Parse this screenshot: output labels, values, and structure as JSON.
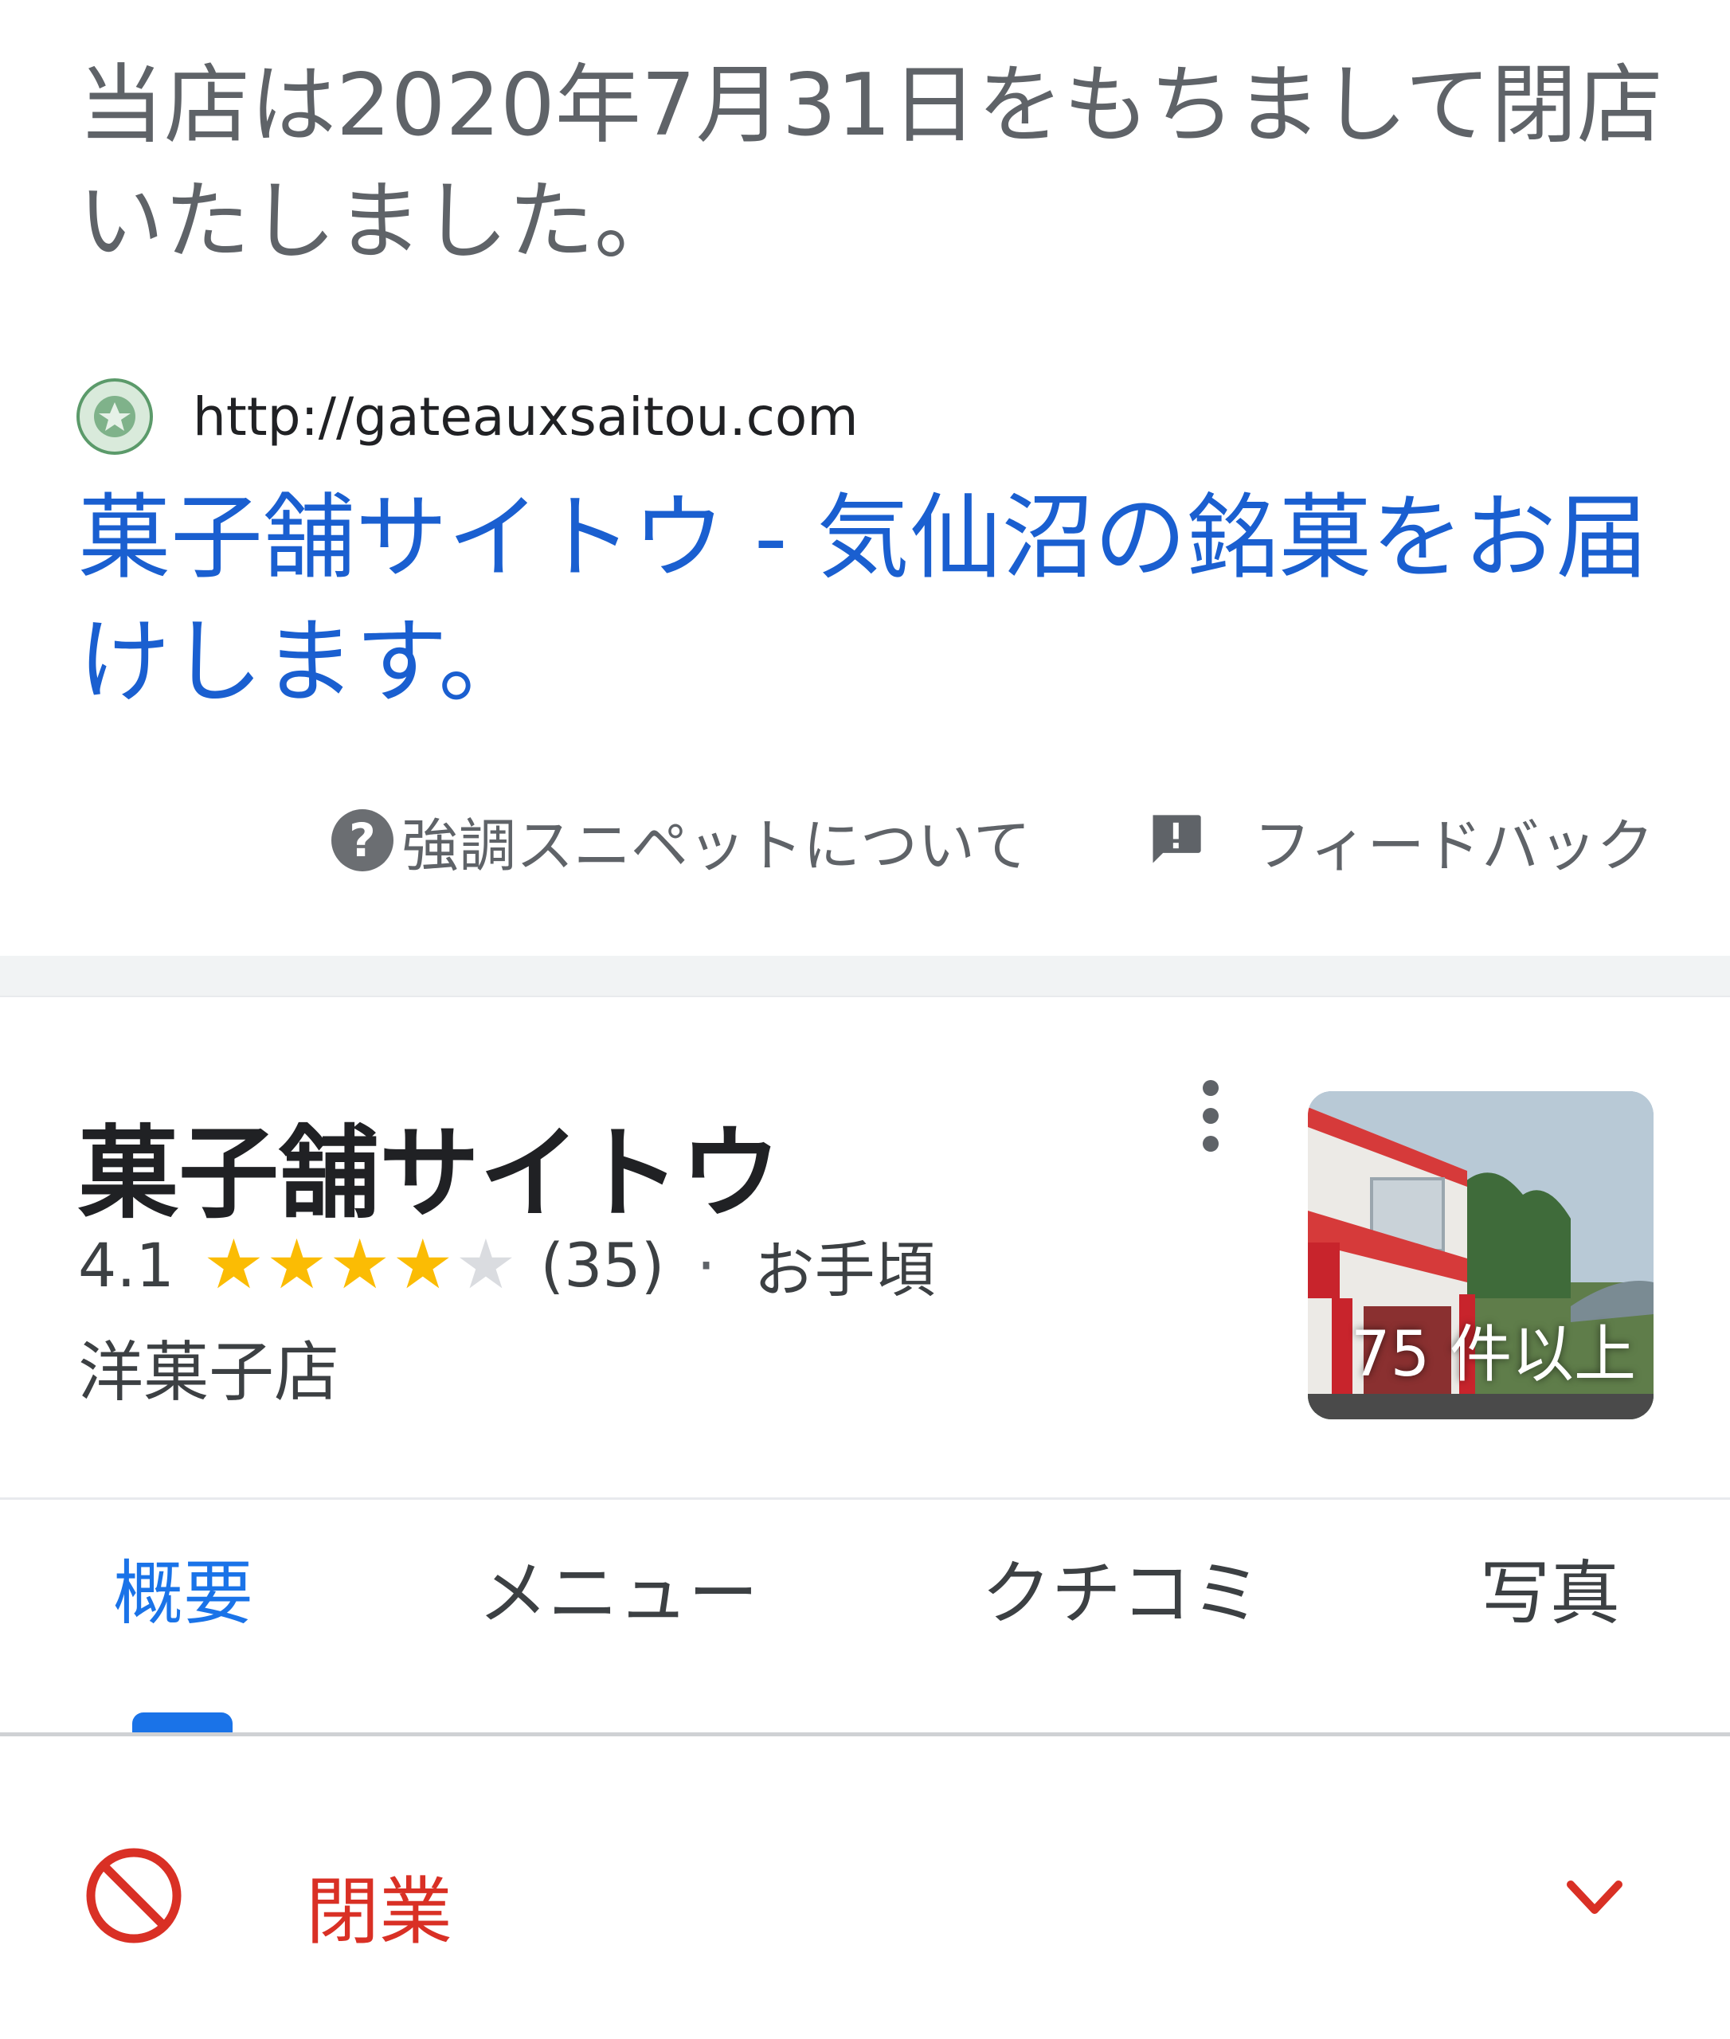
{
  "snippet": {
    "text": "当店は2020年7月31日をもちまして閉店いたしました。",
    "source_url": "http://gateauxsaitou.com",
    "title": "菓子舗サイトウ - 気仙沼の銘菓をお届けします。",
    "about_label": "強調スニペットについて",
    "feedback_label": "フィードバック"
  },
  "business": {
    "name": "菓子舗サイトウ",
    "rating": "4.1",
    "rating_value": 4.1,
    "rating_max": 5,
    "reviews": "(35)",
    "dot": "·",
    "price": "お手頃",
    "category": "洋菓子店",
    "photo_count": "75 件以上"
  },
  "tabs": [
    {
      "label": "概要",
      "active": true
    },
    {
      "label": "メニュー",
      "active": false
    },
    {
      "label": "クチコミ",
      "active": false
    },
    {
      "label": "写真",
      "active": false
    }
  ],
  "status": {
    "label": "閉業"
  },
  "colors": {
    "link": "#1a5fd0",
    "accent": "#1a73e8",
    "star": "#fbbc04",
    "star_empty": "#dadce0",
    "closed": "#d93025"
  },
  "icons": {
    "help": "help-circle-icon",
    "feedback": "feedback-icon",
    "more": "more-vert-icon",
    "closed": "block-icon",
    "expand": "chevron-down-icon"
  }
}
